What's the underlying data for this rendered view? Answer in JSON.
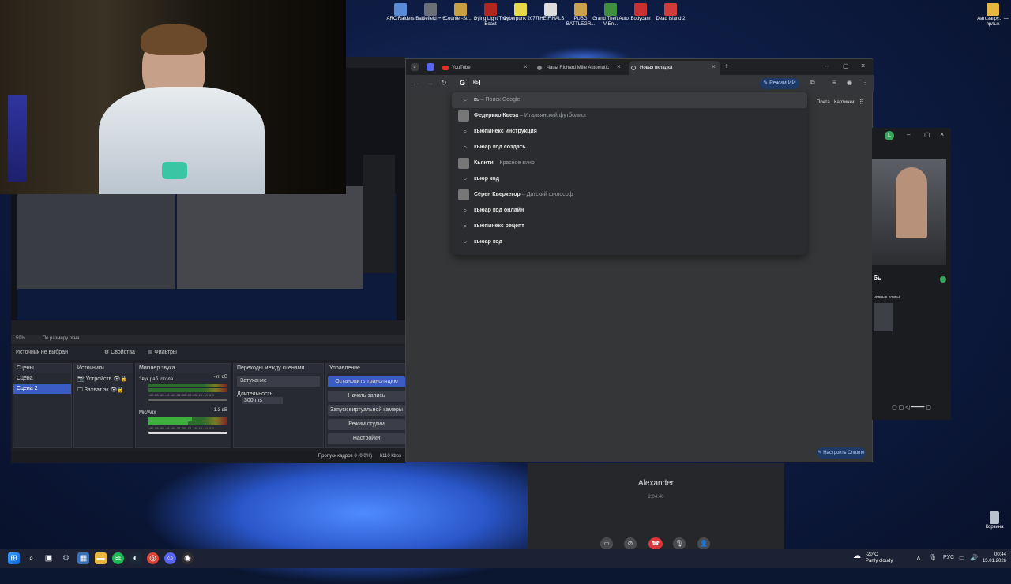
{
  "desktop": {
    "icons": [
      {
        "label": "ARC Raiders",
        "color": "#5a8bd6"
      },
      {
        "label": "Battlefield™ 6",
        "color": "#6b6f78"
      },
      {
        "label": "Counter-Str... 2",
        "color": "#c8a042"
      },
      {
        "label": "Dying Light The Beast",
        "color": "#b3261e"
      },
      {
        "label": "Cyberpunk 2077",
        "color": "#e8d94a"
      },
      {
        "label": "THE FINALS",
        "color": "#dddddd"
      },
      {
        "label": "PUBG BATTLEGR...",
        "color": "#caa24a"
      },
      {
        "label": "Grand Theft Auto V En...",
        "color": "#3f8f3f"
      },
      {
        "label": "Bodycam",
        "color": "#c93030"
      },
      {
        "label": "Dead Island 2",
        "color": "#d13b3b"
      }
    ],
    "right_icon": "Автозагру... — ярлык",
    "recycle": "Корзина"
  },
  "obs": {
    "zoom": "59%",
    "scale_mode": "По размеру окна",
    "no_source": "Источник не выбран",
    "props": "Свойства",
    "filters": "Фильтры",
    "panels": {
      "scenes": "Сцены",
      "sources": "Источники",
      "mixer": "Микшер звука",
      "transitions": "Переходы между сценами",
      "controls": "Управление"
    },
    "scenes": [
      "Сцена",
      "Сцена 2"
    ],
    "sources": [
      "Устройств",
      "Захват эк"
    ],
    "mixer": [
      {
        "name": "Звук раб. стола",
        "db": "-inf dB"
      },
      {
        "name": "Mic/Aux",
        "db": "-1.3 dB"
      }
    ],
    "meter_scale": "-60 -55 -50 -45 -40 -35 -30 -25 -20 -15 -10 -5 0",
    "transition": "Затухание",
    "duration_label": "Длительность",
    "duration": "300 ms",
    "controls": [
      "Остановить трансляцию",
      "Начать запись",
      "Запуск виртуальной камеры",
      "Режим студии",
      "Настройки"
    ],
    "status_dropped": "Пропуск кадров 0 (0.0%)",
    "status_kbps": "6110 kbps"
  },
  "chrome": {
    "tabs": [
      "YouTube",
      "Часы Richard Mille Automatic",
      "Новая вкладка"
    ],
    "address": "кь",
    "ai_mode": "Режим ИИ",
    "links": [
      "Почта",
      "Картинки"
    ],
    "customize": "Настроить Chrome",
    "first_suggestion": {
      "q": "кь",
      "sub": "Поиск Google"
    },
    "suggestions": [
      {
        "q": "Федерико Кьеза",
        "sub": "Итальянский футболист",
        "kind": "img"
      },
      {
        "q": "кьюпинекс инструкция",
        "sub": "",
        "kind": "search"
      },
      {
        "q": "кьюар код создать",
        "sub": "",
        "kind": "search"
      },
      {
        "q": "Кьянти",
        "sub": "Красное вино",
        "kind": "img"
      },
      {
        "q": "кьюр код",
        "sub": "",
        "kind": "search"
      },
      {
        "q": "Сёрен Кьеркегор",
        "sub": "Датский философ",
        "kind": "img"
      },
      {
        "q": "кьюар код онлайн",
        "sub": "",
        "kind": "search"
      },
      {
        "q": "кьюпинекс рецепт",
        "sub": "",
        "kind": "search"
      },
      {
        "q": "кьюар код",
        "sub": "",
        "kind": "search"
      }
    ]
  },
  "call": {
    "name": "Alexander",
    "timer": "2:04:40"
  },
  "discord_right": {
    "avatar_letter": "L",
    "name_frag": "бь",
    "sub_frag": "новные клипы"
  },
  "taskbar": {
    "weather_temp": "-20°C",
    "weather_desc": "Partly cloudy",
    "lang": "РУС",
    "time": "00:44",
    "date": "15.01.2026"
  }
}
